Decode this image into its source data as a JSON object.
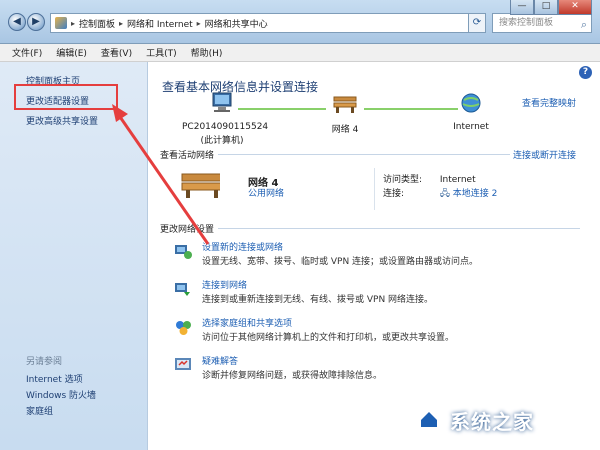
{
  "window": {
    "breadcrumb": [
      "控制面板",
      "网络和 Internet",
      "网络和共享中心"
    ],
    "search_placeholder": "搜索控制面板",
    "buttons": {
      "back": "◀",
      "forward": "▶",
      "refresh": "⟳",
      "min": "—",
      "max": "□",
      "close": "✕"
    }
  },
  "menu": [
    "文件(F)",
    "编辑(E)",
    "查看(V)",
    "工具(T)",
    "帮助(H)"
  ],
  "sidebar": {
    "items": [
      "控制面板主页",
      "更改适配器设置",
      "更改高级共享设置"
    ],
    "see_also_label": "另请参阅",
    "see_also": [
      "Internet 选项",
      "Windows 防火墙",
      "家庭组"
    ]
  },
  "main": {
    "title": "查看基本网络信息并设置连接",
    "full_map_link": "查看完整映射",
    "diagram": {
      "computer_name": "PC2014090115524",
      "computer_note": "(此计算机)",
      "network_label": "网络 4",
      "internet_label": "Internet"
    },
    "active_header": "查看活动网络",
    "connect_link": "连接或断开连接",
    "active_network": {
      "name": "网络 4",
      "type": "公用网络",
      "access_label": "访问类型:",
      "access_value": "Internet",
      "conn_label": "连接:",
      "conn_value": "本地连接 2"
    },
    "change_header": "更改网络设置",
    "tasks": [
      {
        "title": "设置新的连接或网络",
        "desc": "设置无线、宽带、拨号、临时或 VPN 连接；或设置路由器或访问点。"
      },
      {
        "title": "连接到网络",
        "desc": "连接到或重新连接到无线、有线、拨号或 VPN 网络连接。"
      },
      {
        "title": "选择家庭组和共享选项",
        "desc": "访问位于其他网络计算机上的文件和打印机，或更改共享设置。"
      },
      {
        "title": "疑难解答",
        "desc": "诊断并修复网络问题，或获得故障排除信息。"
      }
    ],
    "help": "?"
  },
  "watermark": "系统之家",
  "colors": {
    "link": "#1e5fb3",
    "highlight": "#e53e3e",
    "sidebar": "#dfeaf6"
  }
}
